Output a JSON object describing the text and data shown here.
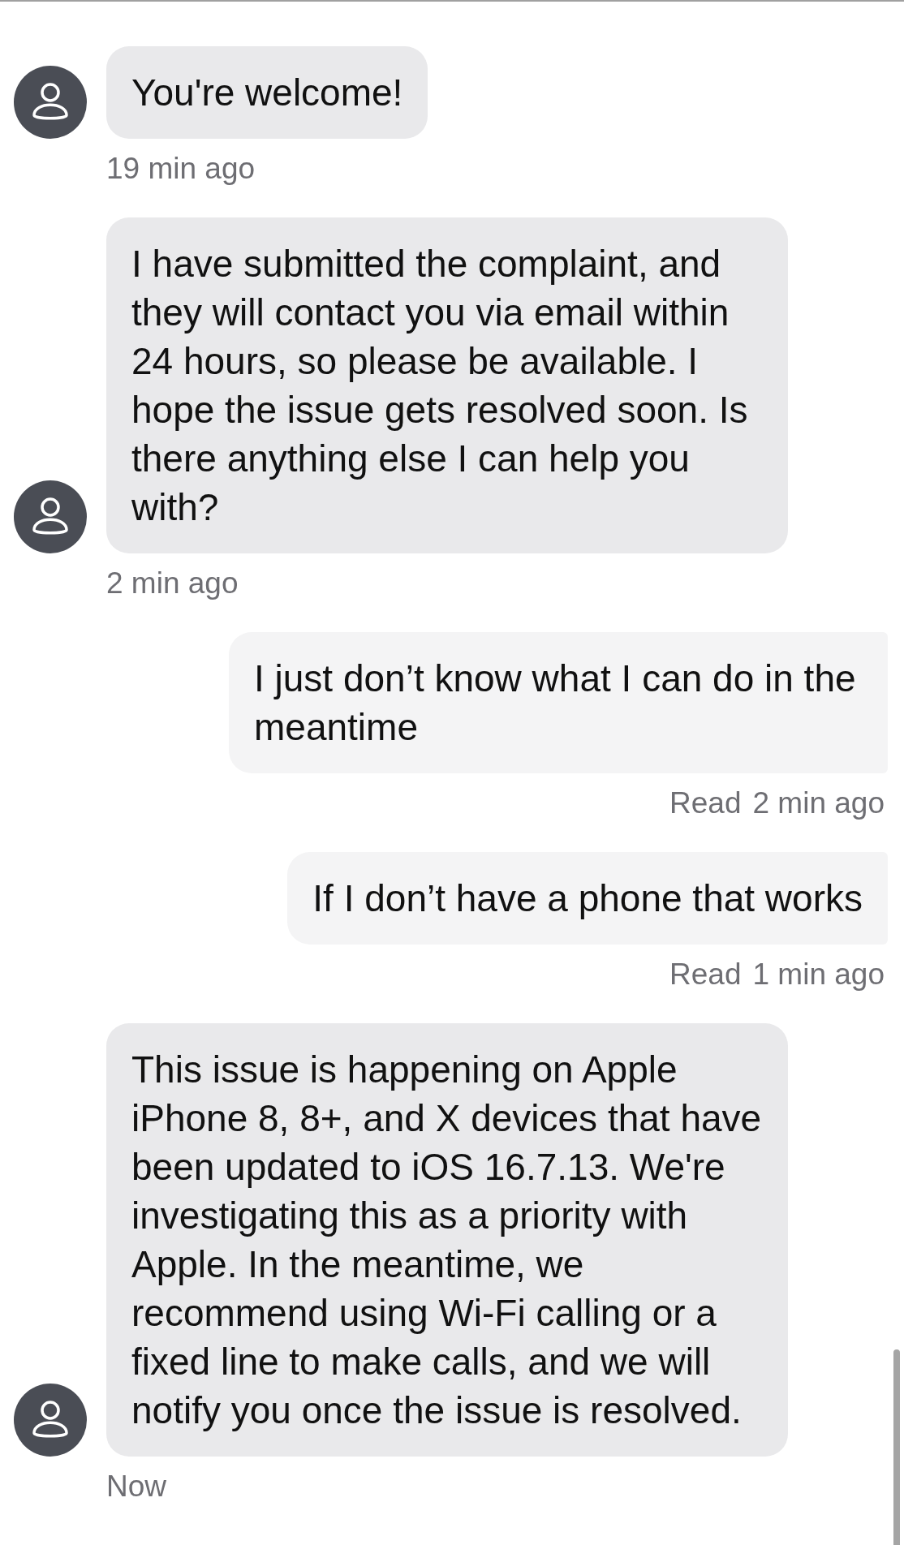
{
  "messages": [
    {
      "kind": "incoming",
      "text": "You're welcome!",
      "time": "19 min ago"
    },
    {
      "kind": "incoming",
      "text": "I have submitted the complaint, and they will contact you via email within 24 hours, so please be available. I hope the issue gets resolved soon. Is there anything else I can help you with?",
      "time": "2 min ago"
    },
    {
      "kind": "outgoing",
      "text": "I just don’t know what I can do in the meantime",
      "status": "Read",
      "time": "2 min ago"
    },
    {
      "kind": "outgoing",
      "text": "If I don’t have a phone that works",
      "status": "Read",
      "time": "1 min ago"
    },
    {
      "kind": "incoming",
      "text": "This issue is happening on Apple iPhone 8, 8+, and X devices that have been updated to iOS 16.7.13. We're investigating this as a priority with Apple. In the meantime, we recommend using Wi-Fi calling or a fixed line to make calls, and we will notify you once the issue is resolved.",
      "time": "Now"
    }
  ]
}
